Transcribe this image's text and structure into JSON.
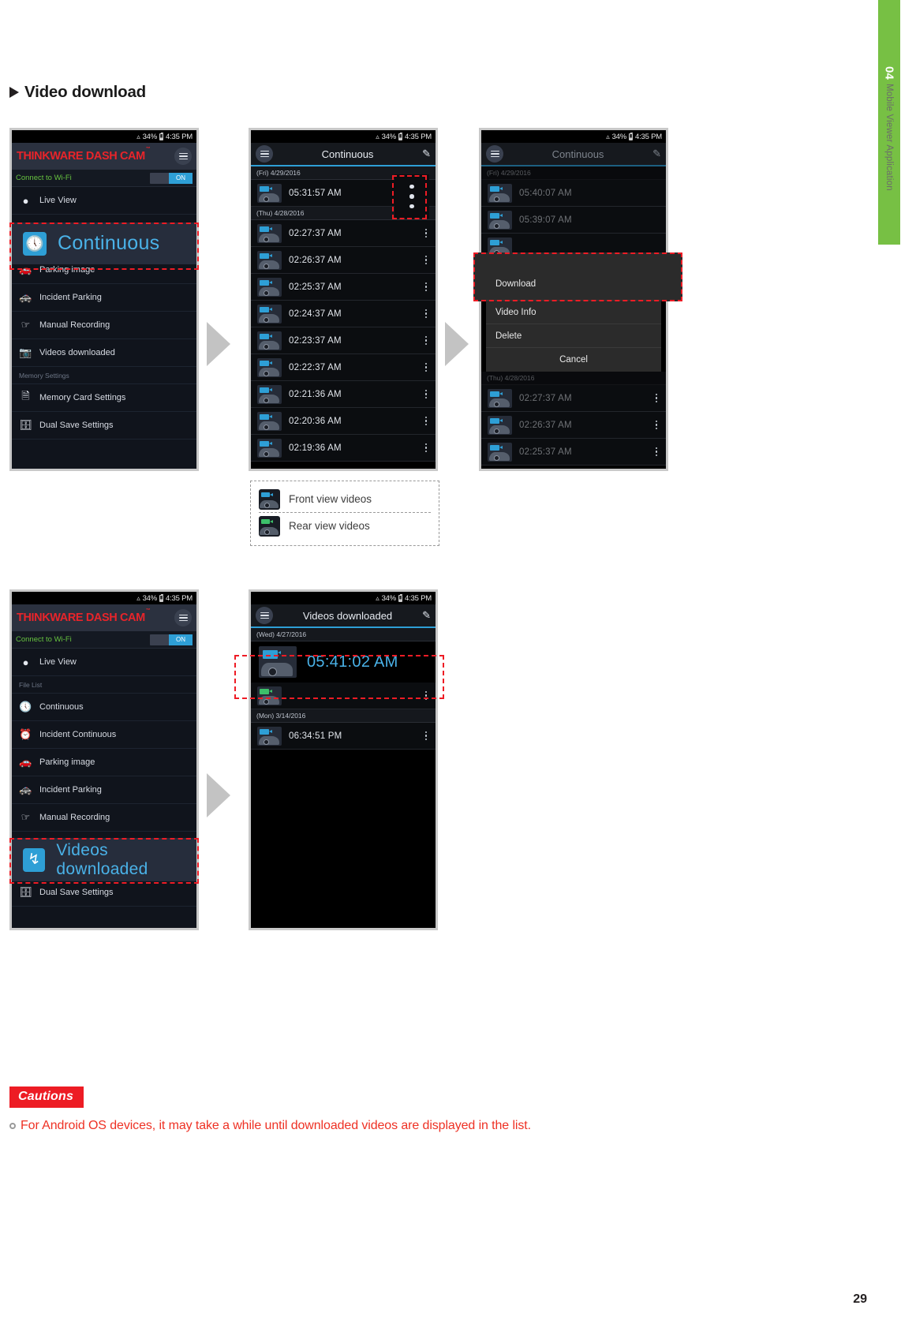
{
  "chapter_tab": {
    "number": "04",
    "label": "Mobile Viewer Application"
  },
  "section": {
    "marker": "triangle-right",
    "title": "Video download"
  },
  "status_bar": {
    "wifi": "wifi-icon",
    "battery_pct": "34%",
    "time": "4:35 PM"
  },
  "drawer1": {
    "brand": "THINKWARE DASH CAM",
    "brand_tm": "™",
    "wifi_label": "Connect to Wi-Fi",
    "toggle_value": "ON",
    "items": [
      {
        "label": "Live View",
        "icon": "live-icon"
      },
      {
        "label": "Parking image",
        "icon": "car-icon"
      },
      {
        "label": "Incident Parking",
        "icon": "car-alert-icon"
      },
      {
        "label": "Manual Recording",
        "icon": "hand-icon"
      },
      {
        "label": "Videos downloaded",
        "icon": "download-image-icon"
      }
    ],
    "section_label": "Memory Settings",
    "settings_items": [
      {
        "label": "Memory Card Settings",
        "icon": "memory-card-icon"
      },
      {
        "label": "Dual Save Settings",
        "icon": "dual-save-icon"
      }
    ],
    "highlight": {
      "label": "Continuous",
      "icon": "clock-icon"
    }
  },
  "drawer2": {
    "brand": "THINKWARE DASH CAM",
    "brand_tm": "™",
    "wifi_label": "Connect to Wi-Fi",
    "toggle_value": "ON",
    "items": [
      {
        "label": "Live View",
        "icon": "live-icon"
      }
    ],
    "file_list_label": "File List",
    "file_items": [
      {
        "label": "Continuous",
        "icon": "clock-icon"
      },
      {
        "label": "Incident Continuous",
        "icon": "clock-alert-icon"
      },
      {
        "label": "Parking image",
        "icon": "car-icon"
      },
      {
        "label": "Incident Parking",
        "icon": "car-alert-icon"
      },
      {
        "label": "Manual Recording",
        "icon": "hand-icon"
      }
    ],
    "highlight": {
      "label": "Videos downloaded",
      "icon": "download-image-icon"
    },
    "tail_items": [
      {
        "label": "Dual Save Settings",
        "icon": "dual-save-icon"
      }
    ]
  },
  "list_continuous": {
    "menu_icon": "hamburger-icon",
    "title": "Continuous",
    "edit_icon": "edit-icon",
    "groups": [
      {
        "date": "(Fri) 4/29/2016",
        "rows": [
          {
            "time": "05:31:57 AM",
            "view": "front"
          }
        ]
      },
      {
        "date": "(Thu) 4/28/2016",
        "rows": [
          {
            "time": "02:27:37 AM",
            "view": "front"
          },
          {
            "time": "02:26:37 AM",
            "view": "front"
          },
          {
            "time": "02:25:37 AM",
            "view": "front"
          },
          {
            "time": "02:24:37 AM",
            "view": "front"
          },
          {
            "time": "02:23:37 AM",
            "view": "front"
          },
          {
            "time": "02:22:37 AM",
            "view": "front"
          },
          {
            "time": "02:21:36 AM",
            "view": "front"
          },
          {
            "time": "02:20:36 AM",
            "view": "front"
          },
          {
            "time": "02:19:36 AM",
            "view": "front"
          }
        ]
      }
    ]
  },
  "list_dialog": {
    "menu_icon": "hamburger-icon",
    "title": "Continuous",
    "edit_icon": "edit-icon",
    "groups": [
      {
        "date": "(Fri) 4/29/2016",
        "rows": [
          {
            "time": "05:40:07 AM",
            "view": "front"
          },
          {
            "time": "05:39:07 AM",
            "view": "front"
          }
        ]
      },
      {
        "date": "(Thu) 4/28/2016",
        "rows": [
          {
            "time": "02:27:37 AM",
            "view": "front"
          },
          {
            "time": "02:26:37 AM",
            "view": "front"
          },
          {
            "time": "02:25:37 AM",
            "view": "front"
          }
        ]
      }
    ],
    "action_sheet": {
      "download": "Download",
      "video_info": "Video Info",
      "delete": "Delete",
      "cancel": "Cancel"
    }
  },
  "list_downloaded": {
    "menu_icon": "hamburger-icon",
    "title": "Videos downloaded",
    "edit_icon": "edit-icon",
    "groups": [
      {
        "date": "(Wed) 4/27/2016",
        "rows": [
          {
            "time": "05:41:02 AM",
            "view": "front",
            "highlighted": true
          },
          {
            "time": "",
            "view": "rear"
          }
        ]
      },
      {
        "date": "(Mon) 3/14/2016",
        "rows": [
          {
            "time": "06:34:51 PM",
            "view": "front"
          }
        ]
      }
    ]
  },
  "legend": {
    "rows": [
      {
        "label": "Front view videos",
        "view": "front"
      },
      {
        "label": "Rear view videos",
        "view": "rear"
      }
    ]
  },
  "cautions": {
    "badge": "Cautions",
    "items": [
      "For Android OS devices, it may take a while until downloaded videos are displayed in the list."
    ]
  },
  "footer": {
    "page_number": "29"
  },
  "colors": {
    "accent_blue": "#2e9fd6",
    "brand_red": "#e8242a",
    "caution_red": "#ee3124",
    "chapter_green": "#77c044"
  }
}
